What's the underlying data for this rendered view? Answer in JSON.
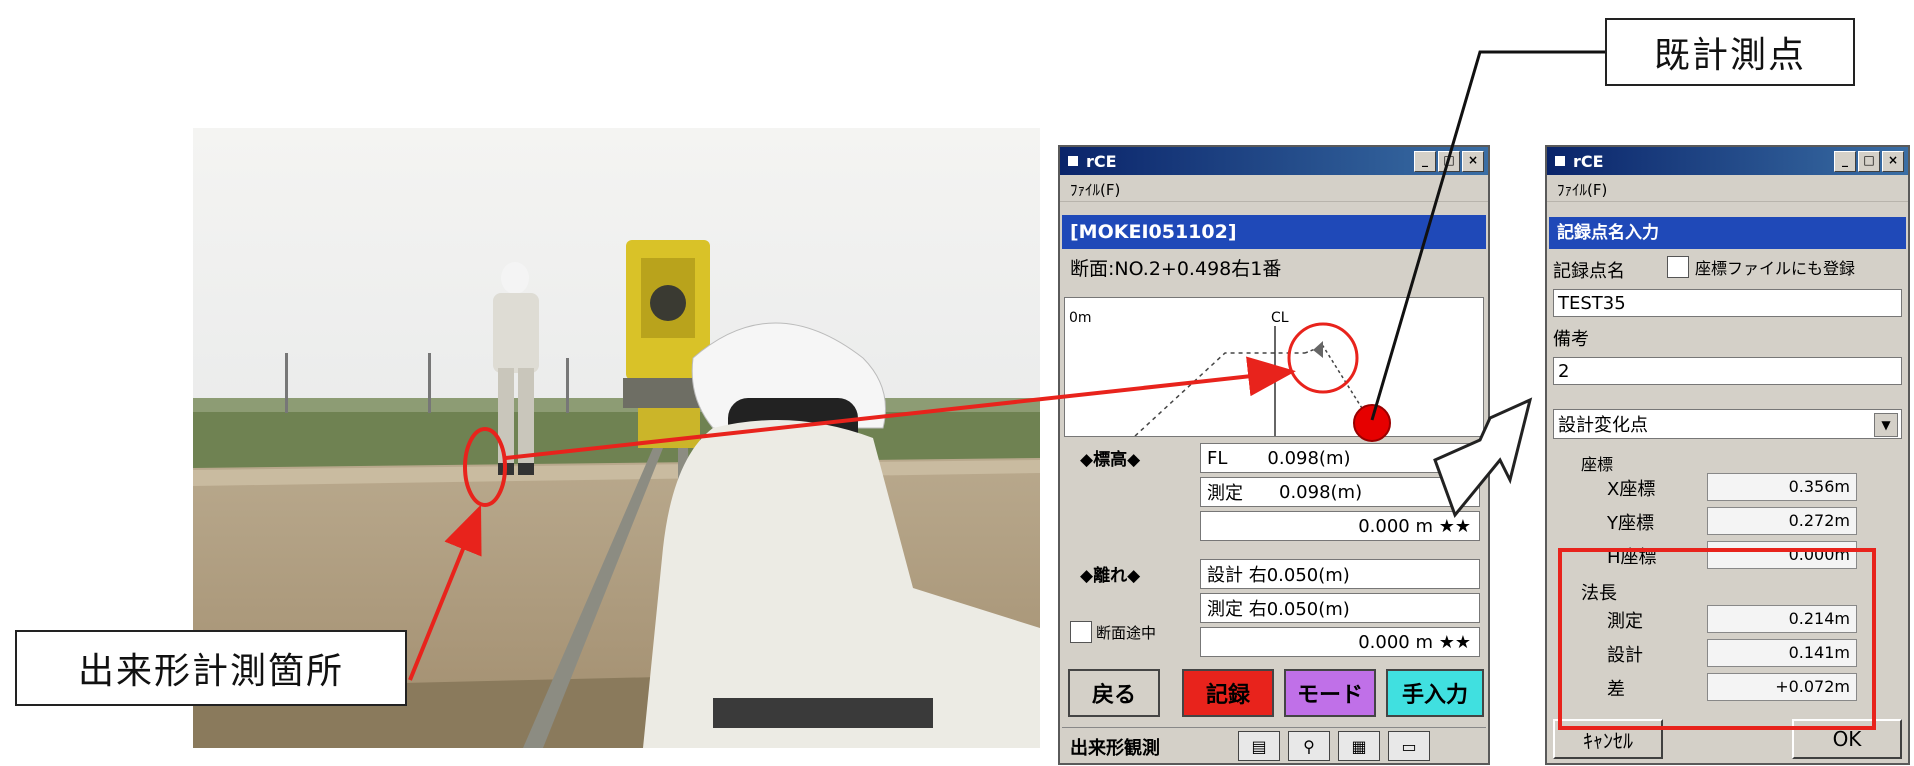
{
  "callouts": {
    "survey_point": "既計測点",
    "measurement_location": "出来形計測箇所"
  },
  "window1": {
    "title": "rCE",
    "menu_file": "ﾌｧｲﾙ(F)",
    "project": "[MOKEI051102]",
    "section": "断面:NO.2+0.498右1番",
    "plot": {
      "left_label": "0m",
      "cl_label": "CL"
    },
    "elevation_label": "◆標高◆",
    "fl_label": "FL",
    "fl_value": "0.098(m)",
    "measured_label": "測定",
    "measured_value": "0.098(m)",
    "elev_diff": "0.000 m ★★",
    "offset_label": "◆離れ◆",
    "design_offset": "設計 右0.050(m)",
    "measured_offset": "測定 右0.050(m)",
    "offset_diff": "0.000 m ★★",
    "section_midway": "断面途中",
    "buttons": {
      "back": "戻る",
      "record": "記録",
      "mode": "モード",
      "manual": "手入力"
    },
    "status_label": "出来形観測",
    "status_icons": [
      "clipboard-icon",
      "magnifier-icon",
      "grid-icon",
      "battery-icon"
    ]
  },
  "window2": {
    "title": "rCE",
    "menu_file": "ﾌｧｲﾙ(F)",
    "dialog_title": "記録点名入力",
    "point_name_label": "記録点名",
    "register_checkbox_label": "座標ファイルにも登録",
    "point_name_value": "TEST35",
    "remarks_label": "備考",
    "remarks_value": "2",
    "type_select": "設計変化点",
    "coords_label": "座標",
    "coords": [
      {
        "label": "X座標",
        "value": "0.356m"
      },
      {
        "label": "Y座標",
        "value": "0.272m"
      },
      {
        "label": "H座標",
        "value": "0.000m"
      }
    ],
    "slope_label": "法長",
    "slope_rows": [
      {
        "label": "測定",
        "value": "0.214m"
      },
      {
        "label": "設計",
        "value": "0.141m"
      },
      {
        "label": "差",
        "value": "+0.072m"
      }
    ],
    "buttons": {
      "cancel": "ｷｬﾝｾﾙ",
      "ok": "OK"
    }
  },
  "colors": {
    "highlight_red": "#e8231c",
    "titlebar_blue": "#0a246a",
    "header_blue": "#1f49b8",
    "record_red": "#e8231c",
    "mode_purple": "#c070e8",
    "manual_cyan": "#40e0e0"
  }
}
